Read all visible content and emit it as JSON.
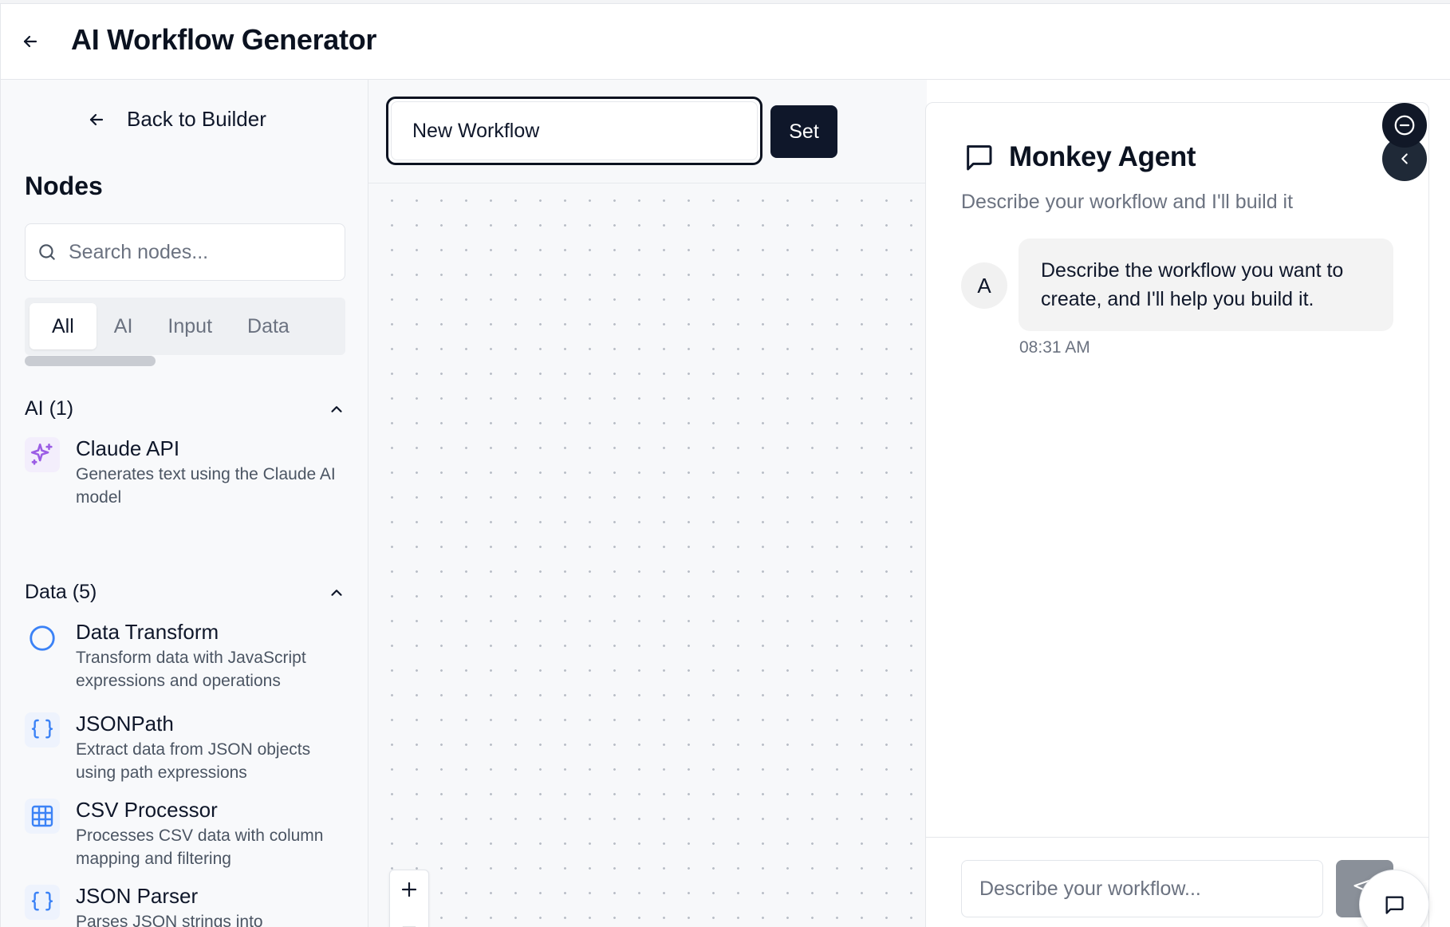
{
  "header": {
    "title": "AI Workflow Generator"
  },
  "sidebar": {
    "back_label": "Back to Builder",
    "nodes_title": "Nodes",
    "search_placeholder": "Search nodes...",
    "tabs": [
      {
        "label": "All",
        "active": true
      },
      {
        "label": "AI"
      },
      {
        "label": "Input"
      },
      {
        "label": "Data"
      }
    ],
    "sections": [
      {
        "label": "AI (1)",
        "items": [
          {
            "name": "Claude API",
            "desc": "Generates text using the Claude AI model",
            "icon": "sparkles-icon",
            "color": "#9b5de5"
          }
        ]
      },
      {
        "label": "Data (5)",
        "items": [
          {
            "name": "Data Transform",
            "desc": "Transform data with JavaScript expressions and operations",
            "icon": "circle-icon",
            "color": "#3b82f6"
          },
          {
            "name": "JSONPath",
            "desc": "Extract data from JSON objects using path expressions",
            "icon": "braces-icon",
            "color": "#3b82f6"
          },
          {
            "name": "CSV Processor",
            "desc": "Processes CSV data with column mapping and filtering",
            "icon": "table-icon",
            "color": "#3b82f6"
          },
          {
            "name": "JSON Parser",
            "desc": "Parses JSON strings into",
            "icon": "braces-icon",
            "color": "#3b82f6"
          }
        ]
      }
    ]
  },
  "canvas": {
    "workflow_name": "New Workflow",
    "set_label": "Set",
    "zoom_in": "+",
    "zoom_out": "−"
  },
  "agent": {
    "title": "Monkey Agent",
    "subtitle": "Describe your workflow and I'll build it",
    "avatar_letter": "A",
    "message": "Describe the workflow you want to create, and I'll help you build it.",
    "time": "08:31 AM",
    "input_placeholder": "Describe your workflow..."
  },
  "colors": {
    "primary": "#0f172a",
    "accent_purple": "#9b5de5",
    "accent_blue": "#3b82f6",
    "send_disabled": "#8a9099"
  }
}
